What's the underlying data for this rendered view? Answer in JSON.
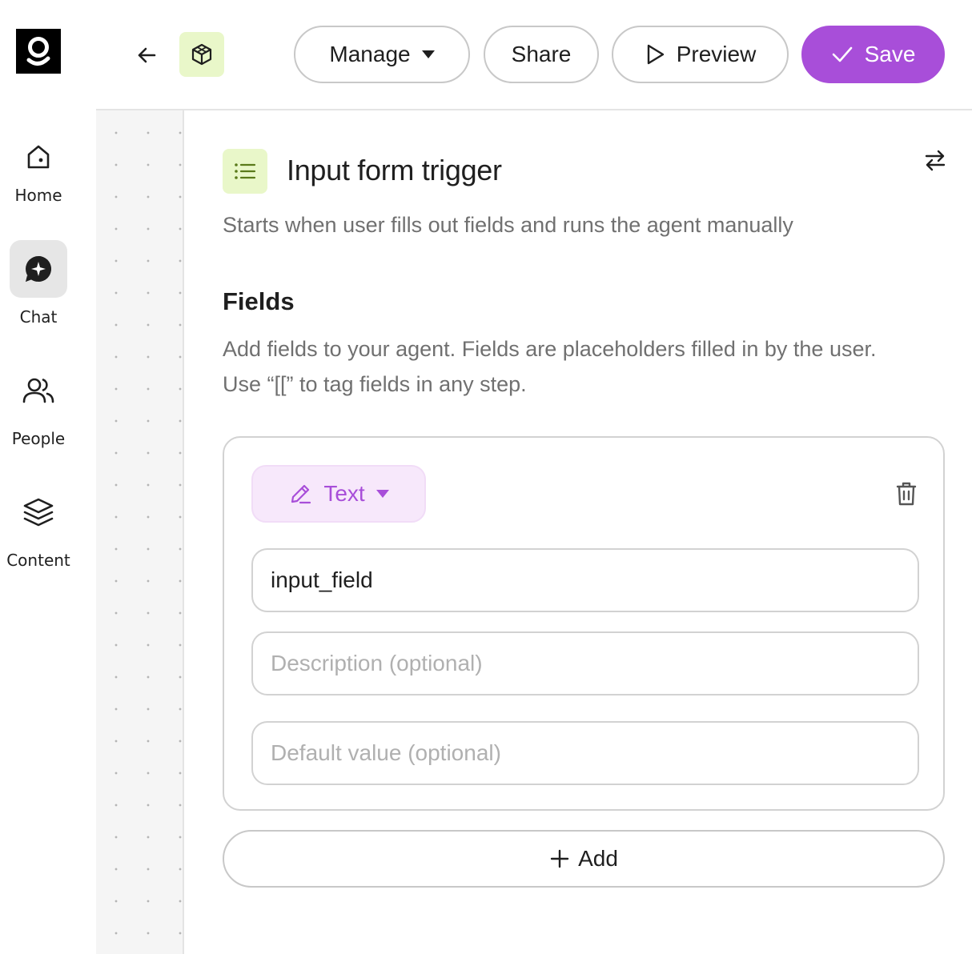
{
  "sidebar": {
    "items": [
      {
        "label": "Home",
        "icon": "home-icon",
        "active": false
      },
      {
        "label": "Chat",
        "icon": "chat-sparkle-icon",
        "active": true
      },
      {
        "label": "People",
        "icon": "people-icon",
        "active": false
      },
      {
        "label": "Content",
        "icon": "layers-icon",
        "active": false
      }
    ]
  },
  "toolbar": {
    "manage_label": "Manage",
    "share_label": "Share",
    "preview_label": "Preview",
    "save_label": "Save"
  },
  "panel": {
    "title": "Input form trigger",
    "subtitle": "Starts when user fills out fields and runs the agent manually",
    "fields_section": {
      "title": "Fields",
      "description_line1": "Add fields to your agent. Fields are placeholders filled in by the user.",
      "description_line2": "Use “[[” to tag fields in any step."
    },
    "field": {
      "type_label": "Text",
      "name_value": "input_field",
      "description_placeholder": "Description (optional)",
      "default_placeholder": "Default value (optional)"
    },
    "add_label": "Add"
  },
  "colors": {
    "accent": "#a84ed9",
    "accent_soft": "#f7e8fb",
    "icon_tile": "#e9f7c9",
    "icon_tile_glyph": "#5a7a1a"
  }
}
